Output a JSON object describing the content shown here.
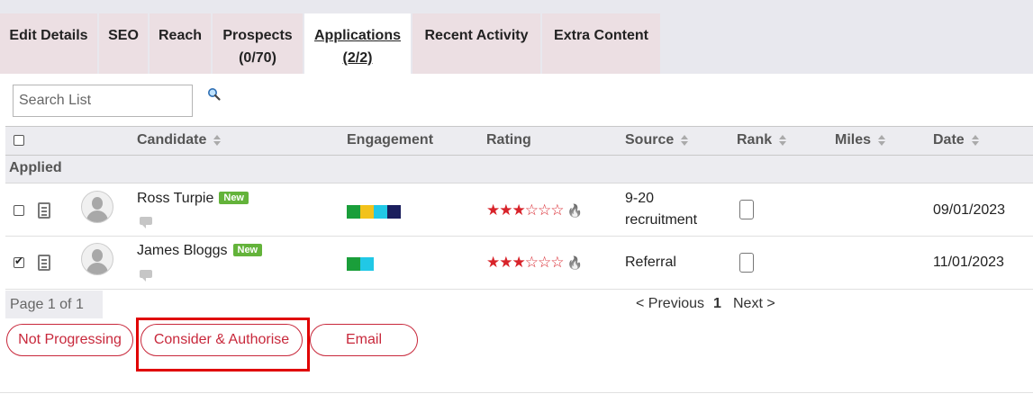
{
  "tabs": [
    {
      "label": "Edit Details"
    },
    {
      "label": "SEO"
    },
    {
      "label": "Reach"
    },
    {
      "label": "Prospects",
      "sub": "(0/70)"
    },
    {
      "label": "Applications",
      "sub": "(2/2)",
      "active": true
    },
    {
      "label": "Recent Activity"
    },
    {
      "label": "Extra Content"
    }
  ],
  "search": {
    "placeholder": "Search List",
    "icon": "search-icon"
  },
  "columns": {
    "candidate": "Candidate",
    "engagement": "Engagement",
    "rating": "Rating",
    "source": "Source",
    "rank": "Rank",
    "miles": "Miles",
    "date": "Date"
  },
  "group_label": "Applied",
  "rows": [
    {
      "name": "Ross Turpie",
      "badge": "New",
      "checked": false,
      "engagement_colors": [
        "#1a9e3a",
        "#f2c21b",
        "#21c8e6",
        "#1b1f5e"
      ],
      "rating": 3,
      "rating_max": 6,
      "source": "9-20 recruitment",
      "date": "09/01/2023"
    },
    {
      "name": "James Bloggs",
      "badge": "New",
      "checked": true,
      "engagement_colors": [
        "#1a9e3a",
        "#21c8e6"
      ],
      "rating": 3,
      "rating_max": 6,
      "source": "Referral",
      "date": "11/01/2023"
    }
  ],
  "pagination": {
    "page_info": "Page 1 of 1",
    "prev": "< Previous",
    "current": "1",
    "next": "Next >"
  },
  "actions": {
    "not_progressing": "Not Progressing",
    "consider_authorise": "Consider & Authorise",
    "email": "Email"
  },
  "colors": {
    "accent": "#c8283b",
    "highlight": "#e00000",
    "tab_bg": "#ecdfe3"
  }
}
